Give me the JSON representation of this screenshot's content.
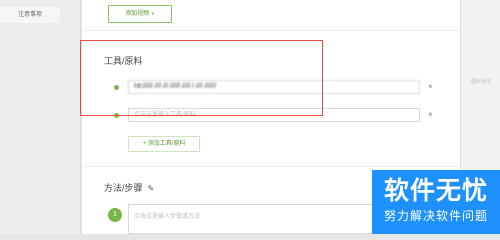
{
  "sidebar": {
    "item_label": "注意事项"
  },
  "top": {
    "add_video_label": "添加视频",
    "chevron": "∨"
  },
  "tools": {
    "title": "工具/原料",
    "items": [
      {
        "value": "htt://////·////·///·//////·/////·/·////·///////",
        "placeholder": ""
      },
      {
        "value": "",
        "placeholder": "点击这里输入工具/原料"
      }
    ],
    "add_label": "+ 添加工具/原料",
    "remove_symbol": "×"
  },
  "steps": {
    "title": "方法/步骤",
    "edit_icon": "✎",
    "items": [
      {
        "number": "1",
        "placeholder": "点击这里输入步骤或方法"
      }
    ],
    "remove_symbol": "×"
  },
  "right_panel": {
    "hint": "图片标注"
  },
  "watermark": {
    "title": "软件无忧",
    "subtitle": "努力解决软件问题"
  },
  "colors": {
    "accent_green": "#7ab648",
    "highlight_red": "#e74c3c",
    "watermark_blue": "#1e90ff"
  }
}
